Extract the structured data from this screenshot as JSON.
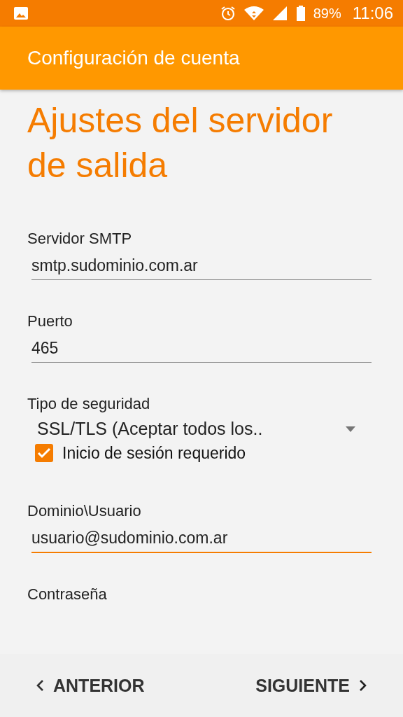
{
  "status_bar": {
    "battery": "89%",
    "time": "11:06"
  },
  "app_bar": {
    "title": "Configuración de cuenta"
  },
  "heading": "Ajustes del servidor de salida",
  "fields": [
    {
      "kind": "text",
      "label": "Servidor SMTP",
      "value": "smtp.sudominio.com.ar",
      "focused": false
    },
    {
      "kind": "text",
      "label": "Puerto",
      "value": "465",
      "focused": false
    },
    {
      "kind": "select",
      "label": "Tipo de seguridad",
      "value": "SSL/TLS (Aceptar todos los.."
    },
    {
      "kind": "checkbox",
      "label": "Inicio de sesión requerido",
      "checked": true
    },
    {
      "kind": "text",
      "label": "Dominio\\Usuario",
      "value": "usuario@sudominio.com.ar",
      "focused": true
    },
    {
      "kind": "label",
      "label": "Contraseña"
    }
  ],
  "buttons": {
    "back": "ANTERIOR",
    "next": "SIGUIENTE"
  }
}
